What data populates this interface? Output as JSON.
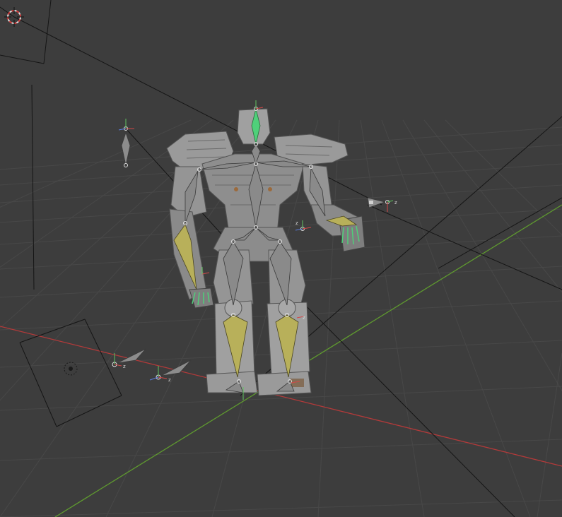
{
  "viewport": {
    "background": "#3d3d3d",
    "grid_color": "#4a4a4a",
    "x_axis_color": "#b33a3a",
    "y_axis_color": "#5f9a2f",
    "relationship_line_color": "#111111"
  },
  "model": {
    "mesh_color": "#9a9a9a",
    "mesh_shadow_color": "#6c6c6c",
    "bone_color": "#8a8a8a",
    "selected_bone_color": "#b8b05a",
    "active_bone_color": "#4fd07a"
  },
  "gizmo_labels": {
    "z": "z"
  },
  "icons": {
    "cursor": "3d-cursor-icon",
    "camera": "camera-icon",
    "light": "light-icon",
    "empty": "empty-icon"
  }
}
